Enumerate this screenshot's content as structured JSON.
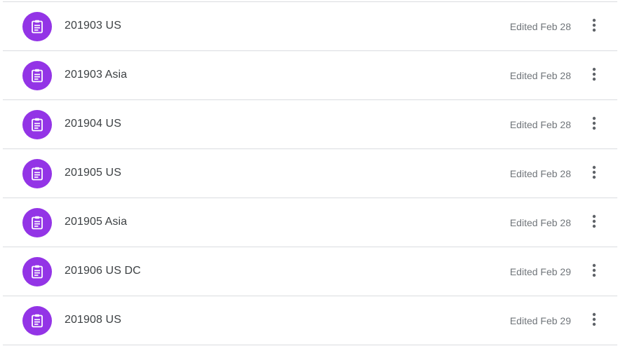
{
  "colors": {
    "avatar_bg": "#9334e6",
    "divider": "#dadce0",
    "title_text": "#3c4043",
    "meta_text": "#70757a",
    "more_icon": "#5f6368"
  },
  "rows": [
    {
      "icon": "clipboard-icon",
      "title": "201903 US",
      "edited": "Edited Feb 28"
    },
    {
      "icon": "clipboard-icon",
      "title": "201903 Asia",
      "edited": "Edited Feb 28"
    },
    {
      "icon": "clipboard-icon",
      "title": "201904 US",
      "edited": "Edited Feb 28"
    },
    {
      "icon": "clipboard-icon",
      "title": "201905 US",
      "edited": "Edited Feb 28"
    },
    {
      "icon": "clipboard-icon",
      "title": "201905 Asia",
      "edited": "Edited Feb 28"
    },
    {
      "icon": "clipboard-icon",
      "title": "201906 US DC",
      "edited": "Edited Feb 29"
    },
    {
      "icon": "clipboard-icon",
      "title": "201908 US",
      "edited": "Edited Feb 29"
    }
  ]
}
